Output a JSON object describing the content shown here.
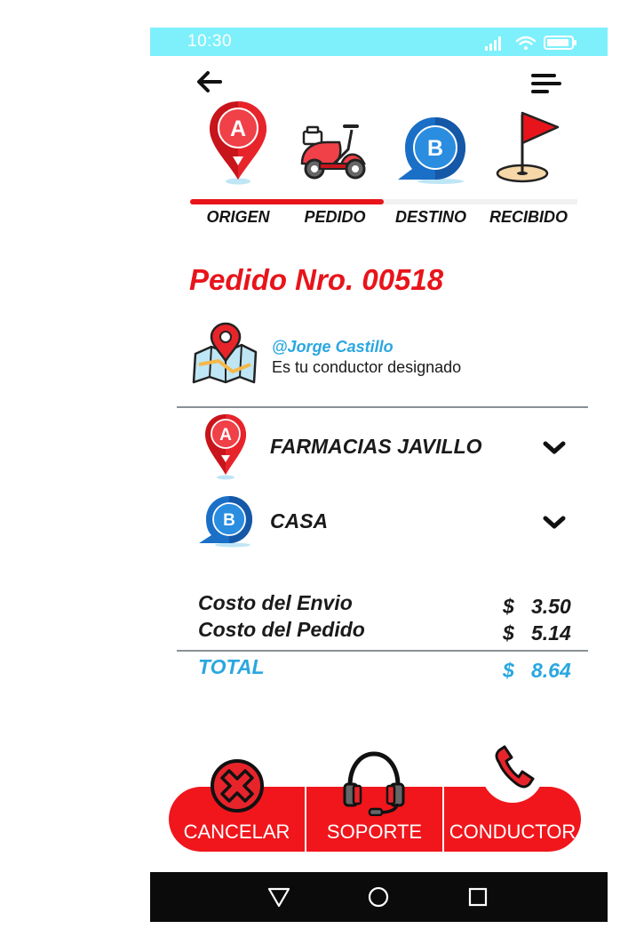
{
  "status_bar": {
    "time": "10:30",
    "icons": [
      "signal-icon",
      "wifi-icon",
      "battery-icon"
    ]
  },
  "header": {
    "back_icon": "arrow-left-icon",
    "menu_icon": "menu-icon"
  },
  "steps": [
    {
      "label": "ORIGEN",
      "icon": "pin-a-icon"
    },
    {
      "label": "PEDIDO",
      "icon": "scooter-icon"
    },
    {
      "label": "DESTINO",
      "icon": "pin-b-icon"
    },
    {
      "label": "RECIBIDO",
      "icon": "flag-icon"
    }
  ],
  "progress": {
    "completed_steps": 2,
    "total_steps": 4
  },
  "order": {
    "title": "Pedido Nro. 00518"
  },
  "driver": {
    "name": "@Jorge Castillo",
    "subtitle": "Es tu conductor designado"
  },
  "locations": {
    "origin": {
      "badge": "A",
      "label": "FARMACIAS JAVILLO"
    },
    "destination": {
      "badge": "B",
      "label": "CASA"
    }
  },
  "costs": {
    "currency": "$",
    "shipping": {
      "label": "Costo del Envio",
      "value": "3.50"
    },
    "order": {
      "label": "Costo del Pedido",
      "value": "5.14"
    },
    "total": {
      "label": "TOTAL",
      "value": "8.64"
    }
  },
  "actions": {
    "cancel": "CANCELAR",
    "support": "SOPORTE",
    "driver": "CONDUCTOR"
  },
  "colors": {
    "brand_red": "#e8141b",
    "accent_blue": "#2aa7e0",
    "status_bar": "#7df0fb",
    "nav_bar": "#0b0b0b"
  }
}
